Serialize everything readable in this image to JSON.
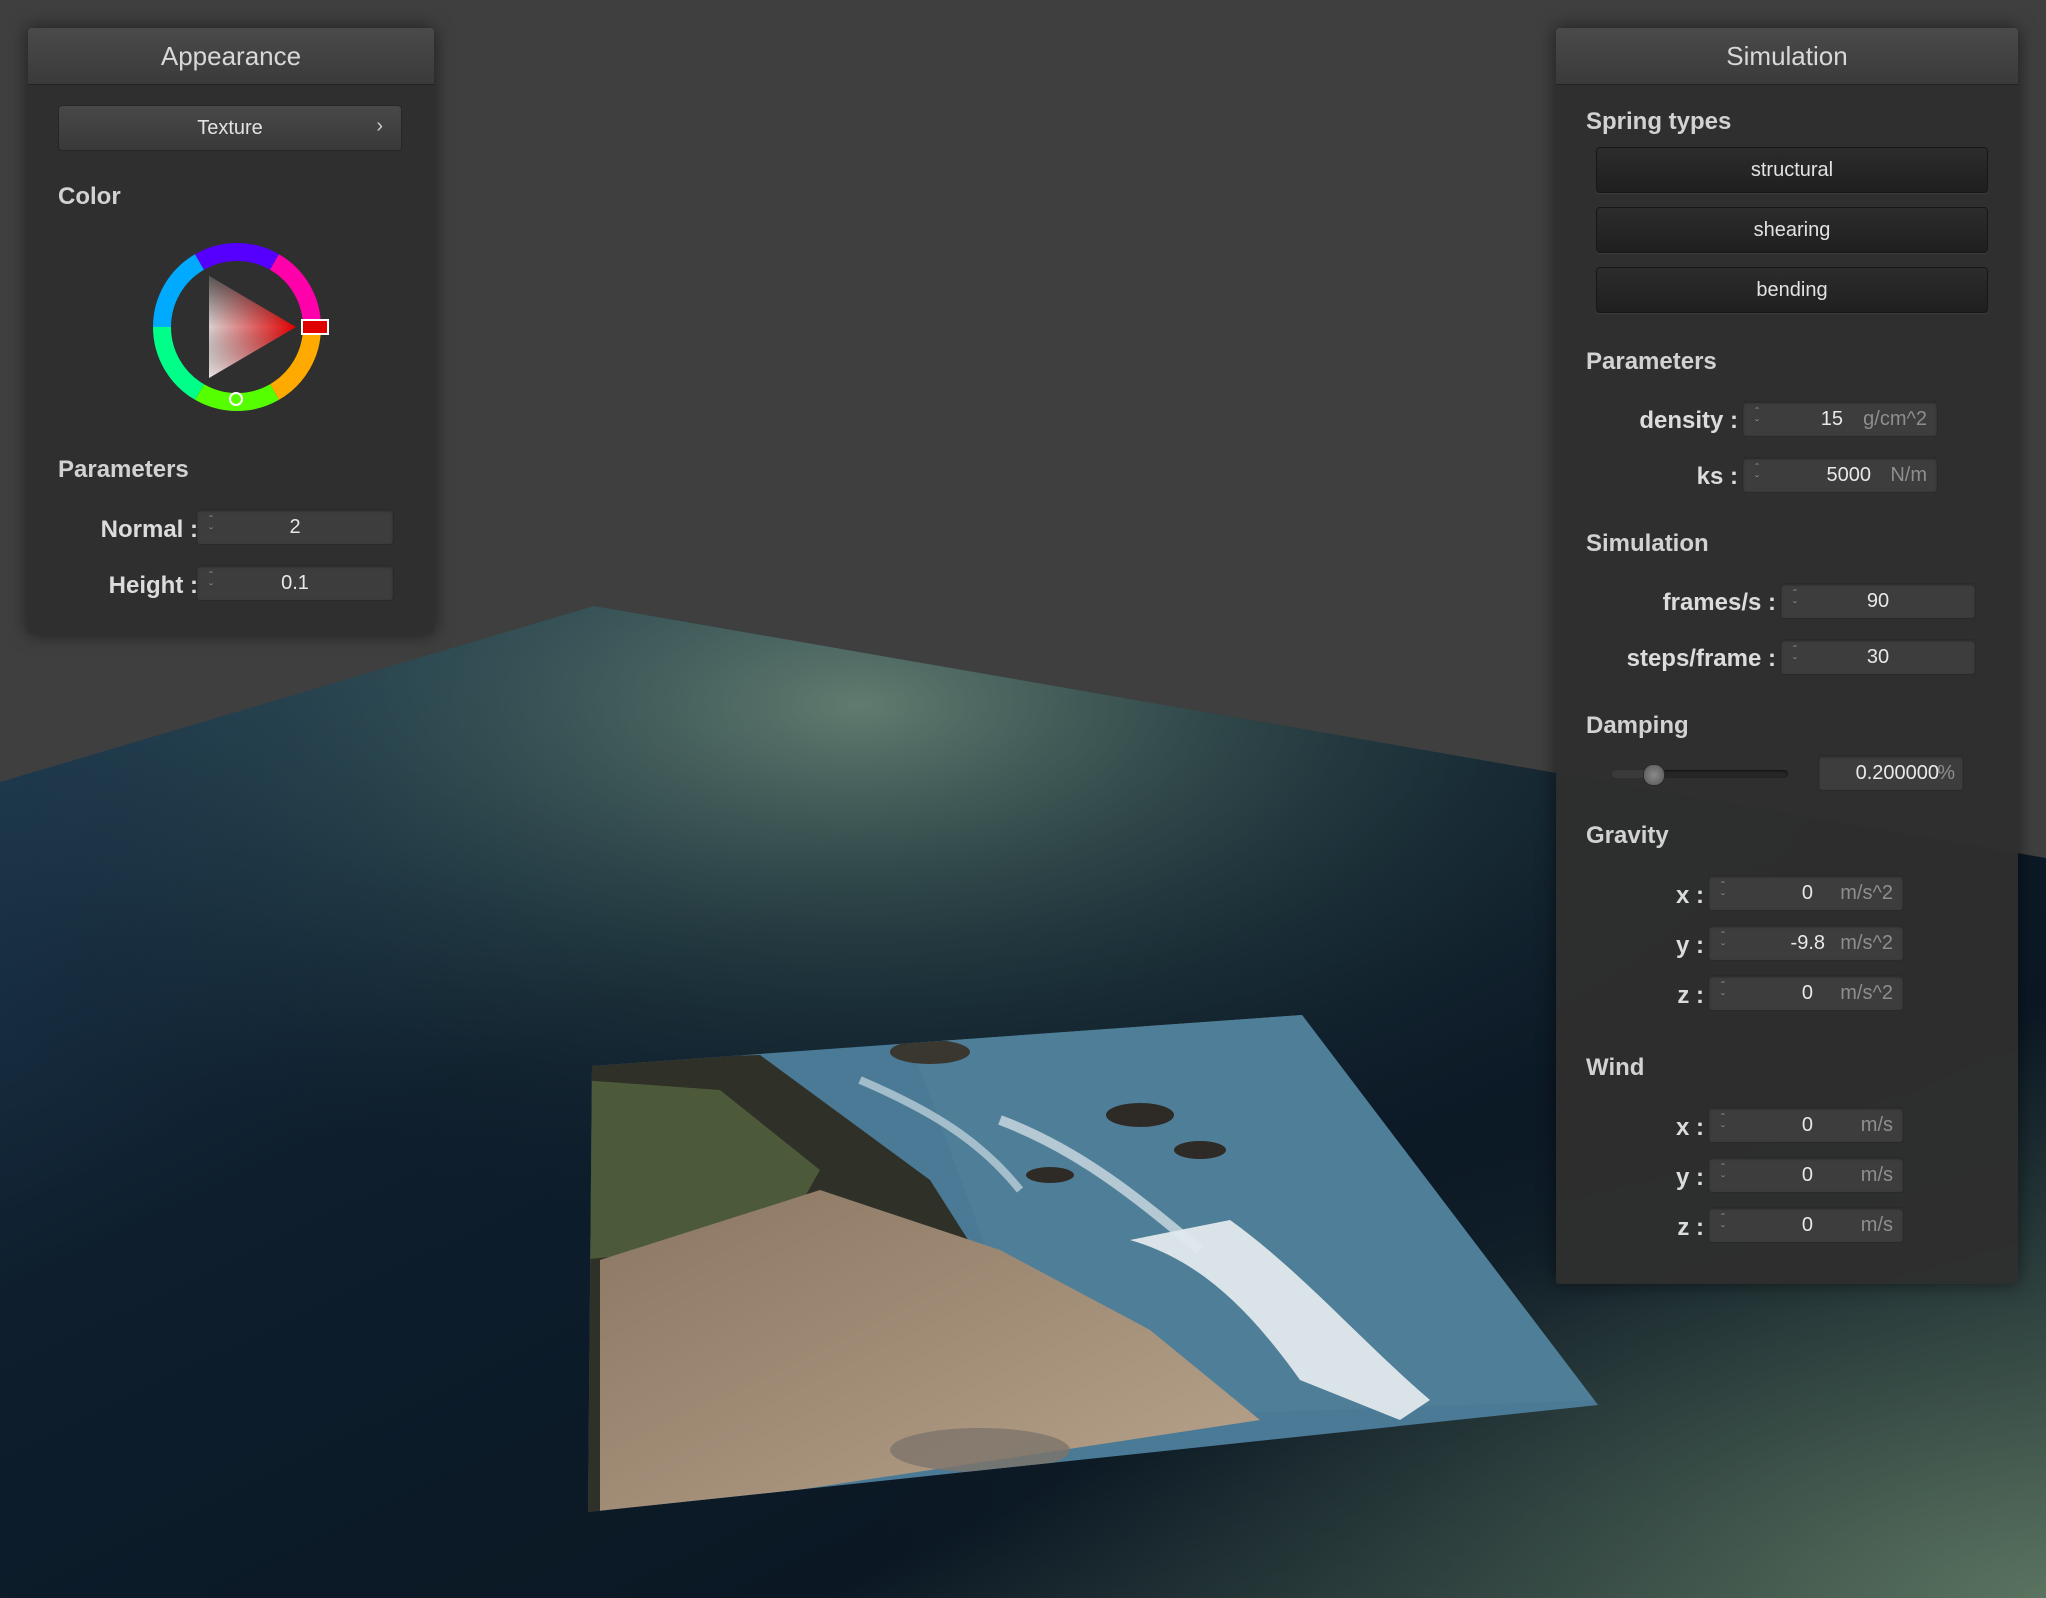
{
  "appearance": {
    "title": "Appearance",
    "texture_button": "Texture",
    "color_label": "Color",
    "params_label": "Parameters",
    "normal_label": "Normal :",
    "normal_value": "2",
    "height_label": "Height :",
    "height_value": "0.1",
    "selected_color": "#ff0000"
  },
  "simulation": {
    "title": "Simulation",
    "spring_types_label": "Spring types",
    "spring_types": [
      "structural",
      "shearing",
      "bending"
    ],
    "params_label": "Parameters",
    "density_label": "density :",
    "density_value": "15",
    "density_unit": "g/cm^2",
    "ks_label": "ks :",
    "ks_value": "5000",
    "ks_unit": "N/m",
    "sim_label": "Simulation",
    "fps_label": "frames/s :",
    "fps_value": "90",
    "steps_label": "steps/frame :",
    "steps_value": "30",
    "damping_label": "Damping",
    "damping_value": "0.200000",
    "damping_unit": "%",
    "damping_level": 0.2,
    "gravity_label": "Gravity",
    "gravity": [
      {
        "label": "x :",
        "value": "0",
        "unit": "m/s^2"
      },
      {
        "label": "y :",
        "value": "-9.8",
        "unit": "m/s^2"
      },
      {
        "label": "z :",
        "value": "0",
        "unit": "m/s^2"
      }
    ],
    "wind_label": "Wind",
    "wind": [
      {
        "label": "x :",
        "value": "0",
        "unit": "m/s"
      },
      {
        "label": "y :",
        "value": "0",
        "unit": "m/s"
      },
      {
        "label": "z :",
        "value": "0",
        "unit": "m/s"
      }
    ]
  },
  "icons": {
    "texture_chevron": "chevron-right-icon",
    "spinner": "spinner-arrows-icon"
  }
}
